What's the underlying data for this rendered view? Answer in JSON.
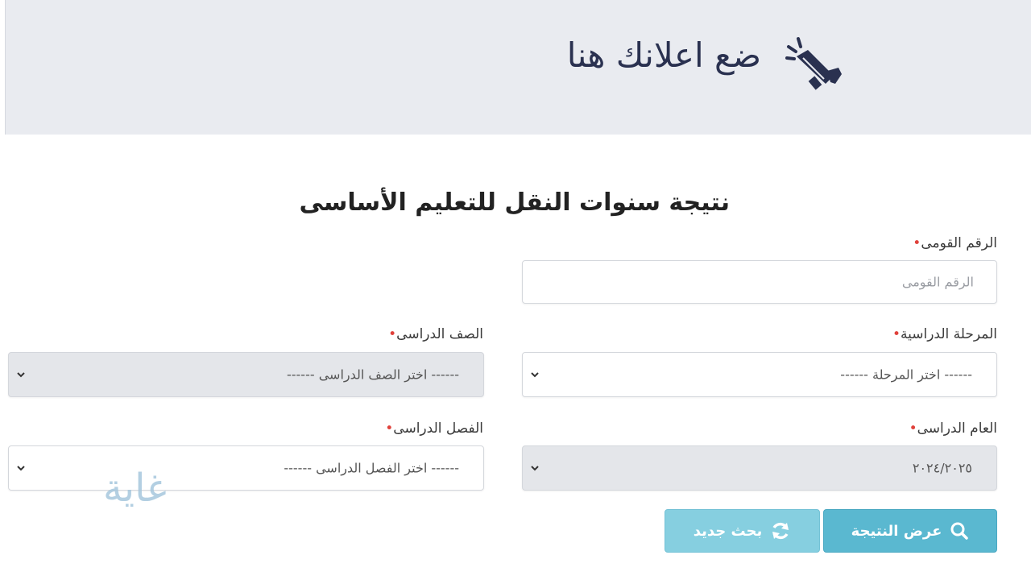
{
  "ad": {
    "text": "ضع اعلانك هنا",
    "icon": "megaphone-icon"
  },
  "form": {
    "title": "نتيجة سنوات النقل للتعليم الأساسى",
    "national_id": {
      "label": "الرقم القومى",
      "placeholder": "الرقم القومى",
      "value": ""
    },
    "stage": {
      "label": "المرحلة الدراسية",
      "selected": "------ اختر المرحلة ------"
    },
    "grade": {
      "label": "الصف الدراسى",
      "selected": "------ اختر الصف الدراسى ------"
    },
    "academic_year": {
      "label": "العام الدراسى",
      "selected": "٢٠٢٤/٢٠٢٥"
    },
    "term": {
      "label": "الفصل الدراسى",
      "selected": "------ اختر الفصل الدراسى ------"
    },
    "required_marker": "•",
    "buttons": {
      "show_result": "عرض النتيجة",
      "new_search": "بحث جديد"
    }
  },
  "watermark": "غاية",
  "colors": {
    "banner_bg": "#e9ebf0",
    "ad_text": "#2a3150",
    "required": "#e0413b",
    "primary_button": "#5ab8d0",
    "secondary_button": "#86cfe0"
  },
  "icons": {
    "search": "search-icon",
    "refresh": "refresh-icon",
    "caret": "chevron-down-icon"
  }
}
